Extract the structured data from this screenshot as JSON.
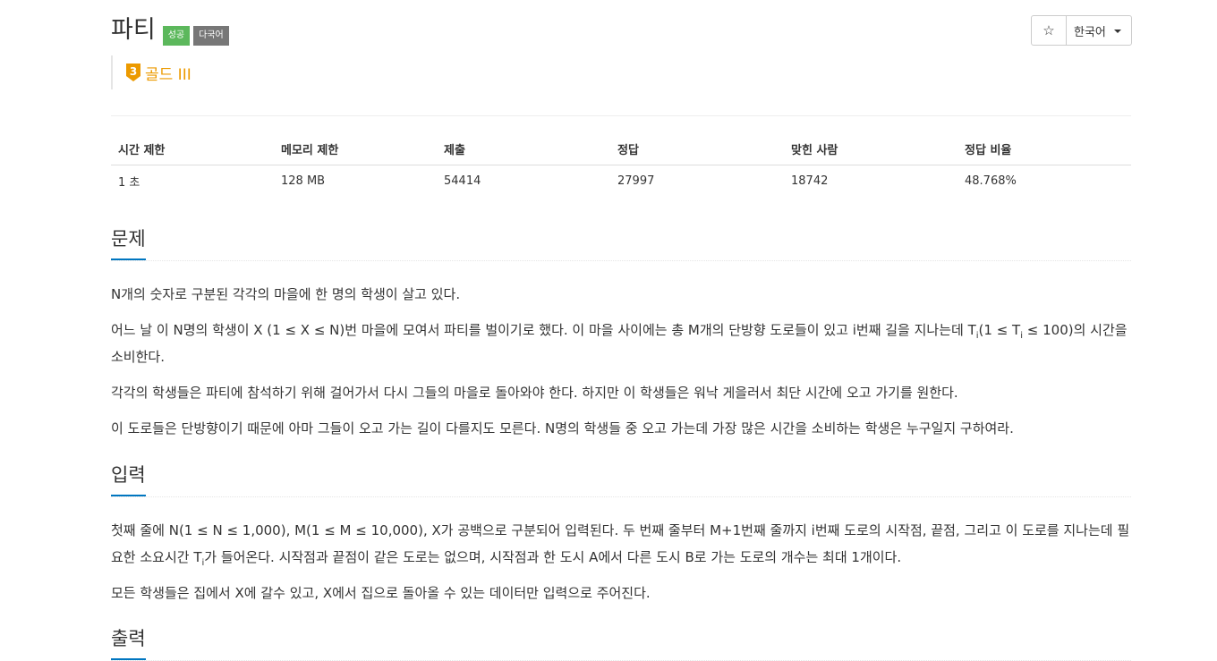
{
  "problem": {
    "title": "파티",
    "badges": {
      "success": "성공",
      "multilang": "다국어"
    },
    "tier": {
      "level": "3",
      "label": "골드 III",
      "color": "#ec9a00"
    }
  },
  "toolbar": {
    "star": "☆",
    "language": "한국어"
  },
  "stats": {
    "headers": [
      "시간 제한",
      "메모리 제한",
      "제출",
      "정답",
      "맞힌 사람",
      "정답 비율"
    ],
    "values": [
      "1 초",
      "128 MB",
      "54414",
      "27997",
      "18742",
      "48.768%"
    ]
  },
  "sections": {
    "problem_title": "문제",
    "input_title": "입력",
    "output_title": "출력"
  },
  "description": {
    "p1": "N개의 숫자로 구분된 각각의 마을에 한 명의 학생이 살고 있다.",
    "p2_a": "어느 날 이 N명의 학생이 X (1 ≤ X ≤ N)번 마을에 모여서 파티를 벌이기로 했다. 이 마을 사이에는 총 M개의 단방향 도로들이 있고 i번째 길을 지나는데 T",
    "p2_sub1": "i",
    "p2_b": "(1 ≤ T",
    "p2_sub2": "i",
    "p2_c": " ≤ 100)의 시간을 소비한다.",
    "p3": "각각의 학생들은 파티에 참석하기 위해 걸어가서 다시 그들의 마을로 돌아와야 한다. 하지만 이 학생들은 워낙 게을러서 최단 시간에 오고 가기를 원한다.",
    "p4": "이 도로들은 단방향이기 때문에 아마 그들이 오고 가는 길이 다를지도 모른다. N명의 학생들 중 오고 가는데 가장 많은 시간을 소비하는 학생은 누구일지 구하여라."
  },
  "input": {
    "p1_a": "첫째 줄에 N(1 ≤ N ≤ 1,000), M(1 ≤ M ≤ 10,000), X가 공백으로 구분되어 입력된다. 두 번째 줄부터 M+1번째 줄까지 i번째 도로의 시작점, 끝점, 그리고 이 도로를 지나는데 필요한 소요시간 T",
    "p1_sub": "i",
    "p1_b": "가 들어온다. 시작점과 끝점이 같은 도로는 없으며, 시작점과 한 도시 A에서 다른 도시 B로 가는 도로의 개수는 최대 1개이다.",
    "p2": "모든 학생들은 집에서 X에 갈수 있고, X에서 집으로 돌아올 수 있는 데이터만 입력으로 주어진다."
  }
}
